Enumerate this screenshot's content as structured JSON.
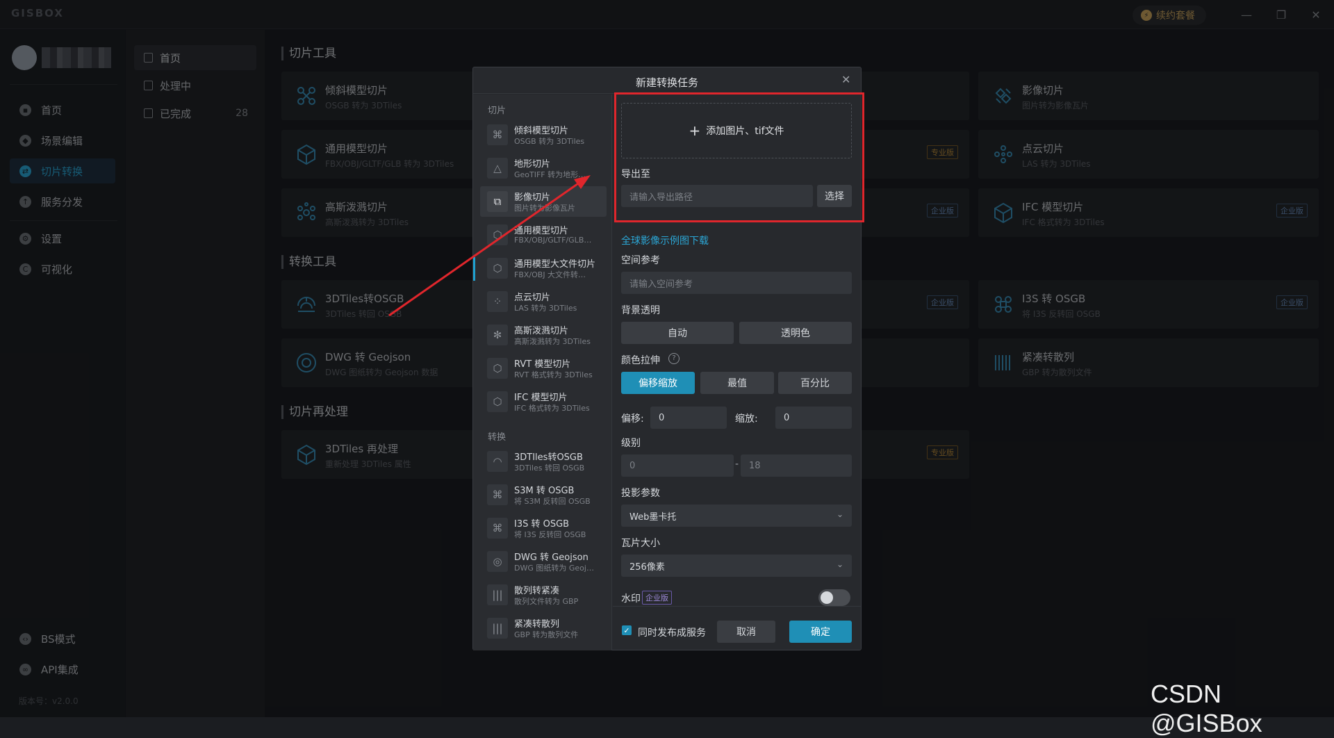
{
  "app": {
    "logo": "GISBOX",
    "renew_label": "续约套餐",
    "version": "版本号：v2.0.0"
  },
  "nav": {
    "items": [
      {
        "label": "首页",
        "icon": "home-icon"
      },
      {
        "label": "场景编辑",
        "icon": "cube-icon"
      },
      {
        "label": "切片转换",
        "icon": "convert-icon"
      },
      {
        "label": "服务分发",
        "icon": "upload-icon"
      },
      {
        "label": "设置",
        "icon": "gear-icon"
      },
      {
        "label": "可视化",
        "icon": "visual-icon"
      }
    ],
    "bottom": [
      {
        "label": "BS模式",
        "icon": "code-icon"
      },
      {
        "label": "API集成",
        "icon": "link-icon"
      }
    ]
  },
  "subnav": {
    "items": [
      {
        "label": "首页"
      },
      {
        "label": "处理中"
      },
      {
        "label": "已完成",
        "count": "28"
      }
    ]
  },
  "main": {
    "sections": [
      {
        "title": "切片工具"
      },
      {
        "title": "转换工具"
      },
      {
        "title": "切片再处理"
      }
    ],
    "cards": [
      {
        "title": "倾斜模型切片",
        "sub": "OSGB 转为 3DTiles"
      },
      {
        "title": "通用模型切片",
        "sub": "FBX/OBJ/GLTF/GLB 转为 3DTiles"
      },
      {
        "title": "高斯泼溅切片",
        "sub": "高斯泼溅转为 3DTiles"
      },
      {
        "title": "影像切片",
        "sub": "图片转为影像瓦片"
      },
      {
        "title": "点云切片",
        "sub": "LAS 转为 3DTiles"
      },
      {
        "title": "IFC 模型切片",
        "sub": "IFC 格式转为 3DTiles"
      },
      {
        "title": "3DTiles转OSGB",
        "sub": "3DTiles 转回 OSGB"
      },
      {
        "title": "DWG 转 Geojson",
        "sub": "DWG 图纸转为 Geojson 数据"
      },
      {
        "title": "I3S 转 OSGB",
        "sub": "将 I3S 反转回 OSGB"
      },
      {
        "title": "紧凑转散列",
        "sub": "GBP 转为散列文件"
      },
      {
        "title": "3DTiles 再处理",
        "sub": "重新处理 3DTiles 属性"
      }
    ],
    "badges": {
      "pro": "专业版",
      "ent": "企业版"
    }
  },
  "modal": {
    "title": "新建转换任务",
    "group_slice": "切片",
    "group_convert": "转换",
    "slice_items": [
      {
        "title": "倾斜模型切片",
        "sub": "OSGB 转为 3DTiles"
      },
      {
        "title": "地形切片",
        "sub": "GeoTIFF 转为地形…"
      },
      {
        "title": "影像切片",
        "sub": "图片转为影像瓦片"
      },
      {
        "title": "通用模型切片",
        "sub": "FBX/OBJ/GLTF/GLB…"
      },
      {
        "title": "通用模型大文件切片",
        "sub": "FBX/OBJ 大文件转…"
      },
      {
        "title": "点云切片",
        "sub": "LAS 转为 3DTiles"
      },
      {
        "title": "高斯泼溅切片",
        "sub": "高斯泼溅转为 3DTiles"
      },
      {
        "title": "RVT 模型切片",
        "sub": "RVT 格式转为 3DTiles"
      },
      {
        "title": "IFC 模型切片",
        "sub": "IFC 格式转为 3DTiles"
      }
    ],
    "convert_items": [
      {
        "title": "3DTIles转OSGB",
        "sub": "3DTiles 转回 OSGB"
      },
      {
        "title": "S3M 转 OSGB",
        "sub": "将 S3M 反转回 OSGB"
      },
      {
        "title": "I3S 转 OSGB",
        "sub": "将 I3S 反转回 OSGB"
      },
      {
        "title": "DWG 转 Geojson",
        "sub": "DWG 图纸转为 Geoj…"
      },
      {
        "title": "散列转紧凑",
        "sub": "散列文件转为 GBP"
      },
      {
        "title": "紧凑转散列",
        "sub": "GBP 转为散列文件"
      }
    ],
    "form": {
      "upload_label": "添加图片、tif文件",
      "export_label": "导出至",
      "export_placeholder": "请输入导出路径",
      "choose_label": "选择",
      "sample_link": "全球影像示例图下载",
      "srs_label": "空间参考",
      "srs_placeholder": "请输入空间参考",
      "bg_label": "背景透明",
      "bg_options": [
        "自动",
        "透明色"
      ],
      "stretch_label": "颜色拉伸",
      "stretch_options": [
        "偏移缩放",
        "最值",
        "百分比"
      ],
      "offset_label": "偏移:",
      "offset_value": "0",
      "scale_label": "缩放:",
      "scale_value": "0",
      "level_label": "级别",
      "level_min": "0",
      "level_sep": "-",
      "level_max": "18",
      "proj_label": "投影参数",
      "proj_value": "Web墨卡托",
      "tile_label": "瓦片大小",
      "tile_value": "256像素",
      "watermark_label": "水印",
      "watermark_badge": "企业版",
      "publish_label": "同时发布成服务",
      "cancel_label": "取消",
      "ok_label": "确定"
    }
  },
  "watermark": "CSDN @GISBox",
  "colors": {
    "accent": "#1f8fb6",
    "highlight": "#e0262c"
  }
}
